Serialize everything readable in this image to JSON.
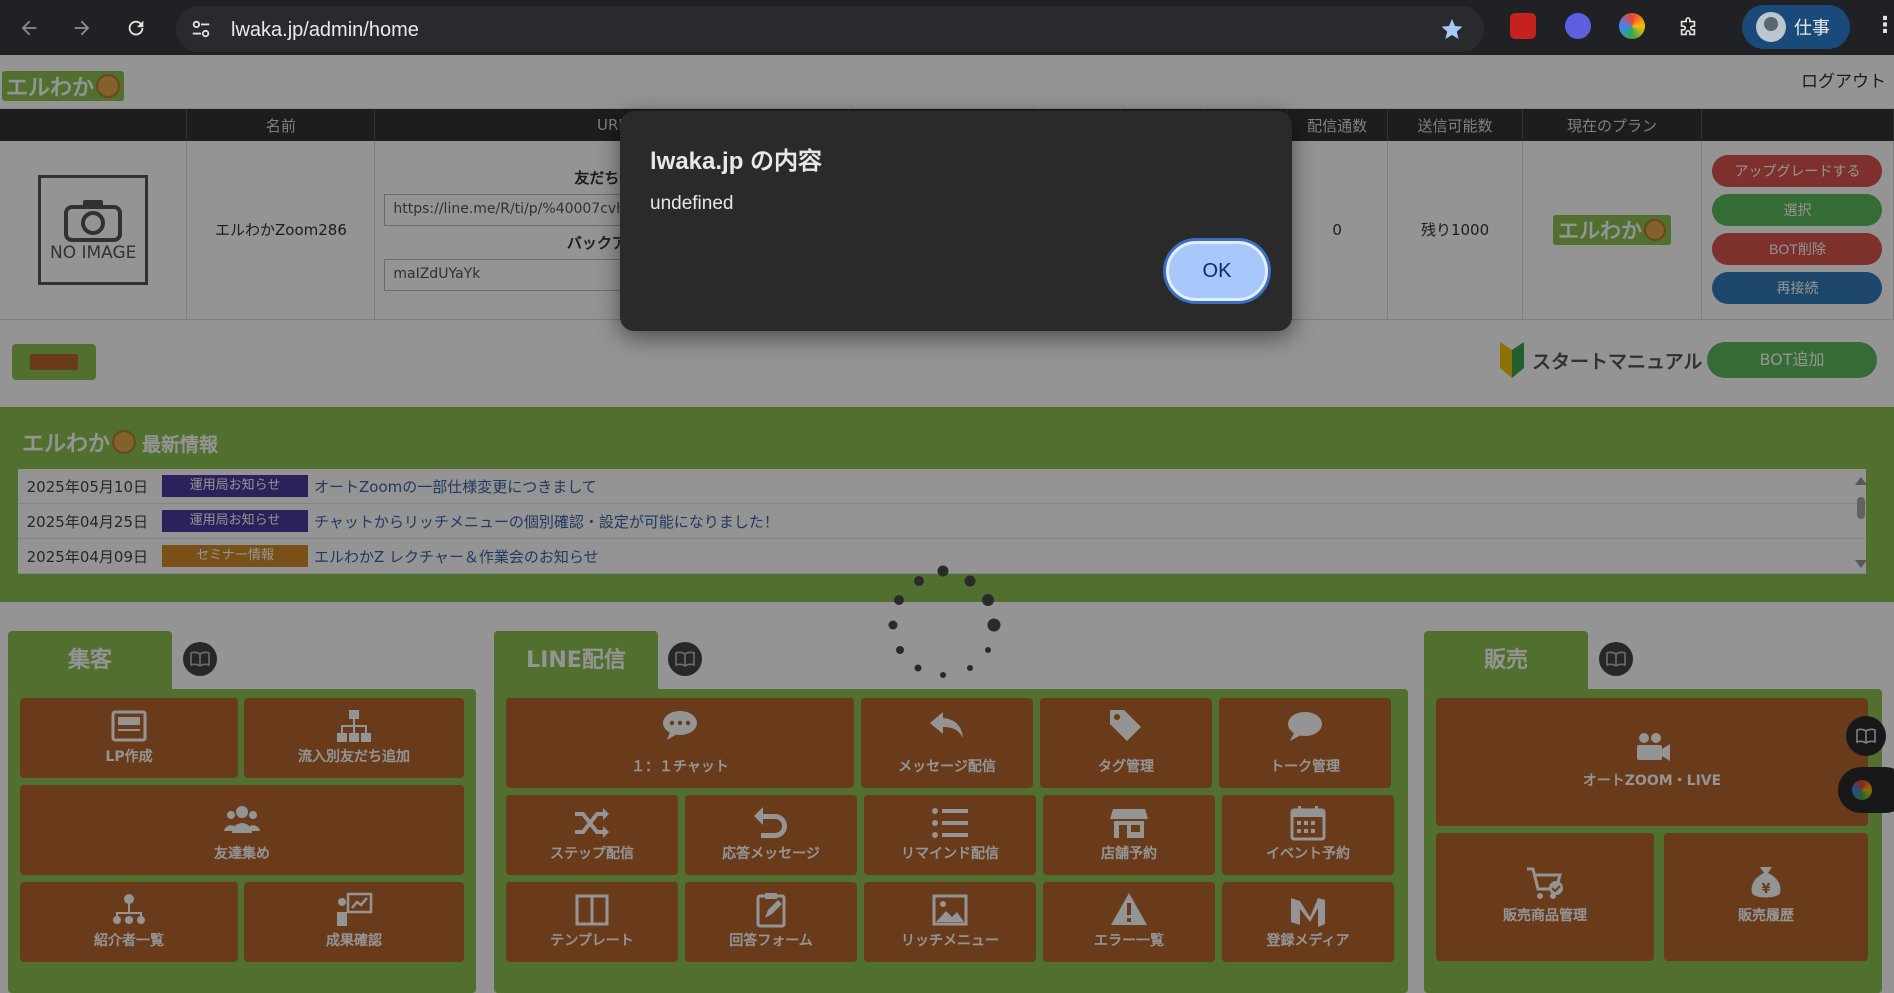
{
  "browser": {
    "url": "lwaka.jp/admin/home",
    "profile_label": "仕事"
  },
  "header": {
    "logo_text": "エルわか",
    "logout_label": "ログアウト"
  },
  "bot_table": {
    "headers": [
      "",
      "名前",
      "URL",
      "",
      "",
      "",
      "",
      "配信通数",
      "送信可能数",
      "現在のプラン",
      ""
    ],
    "row": {
      "no_image_label": "NO IMAGE",
      "name": "エルわかZoom286",
      "friend_add_label": "友だち追加",
      "friend_add_url": "https://line.me/R/ti/p/%40007cvh",
      "backup_label": "バックアップ",
      "backup_code": "maIZdUYaYk",
      "delivery_count": "0",
      "sendable": "残り1000",
      "plan_logo": "エルわか",
      "actions": {
        "upgrade": "アップグレードする",
        "select": "選択",
        "bot_delete": "BOT削除",
        "reconnect": "再接続"
      }
    }
  },
  "toolbar": {
    "start_manual_label": "スタートマニュアル",
    "bot_add_label": "BOT追加"
  },
  "news": {
    "logo_text": "エルわか",
    "title_suffix": "最新情報",
    "items": [
      {
        "date": "2025年05月10日",
        "tag": "運用局お知らせ",
        "tag_color": "#4b3a9e",
        "title": "オートZoomの一部仕様変更につきまして"
      },
      {
        "date": "2025年04月25日",
        "tag": "運用局お知らせ",
        "tag_color": "#4b3a9e",
        "title": "チャットからリッチメニューの個別確認・設定が可能になりました！"
      },
      {
        "date": "2025年04月09日",
        "tag": "セミナー情報",
        "tag_color": "#d08a2a",
        "title": "エルわかZ レクチャー＆作業会のお知らせ"
      }
    ]
  },
  "sections": {
    "shukyaku": {
      "title": "集客",
      "tiles": {
        "lp": "LP作成",
        "inflow": "流入別友だち追加",
        "friends": "友達集め",
        "referrers": "紹介者一覧",
        "results": "成果確認"
      }
    },
    "line": {
      "title": "LINE配信",
      "tiles": {
        "chat": "１：１チャット",
        "message": "メッセージ配信",
        "tag": "タグ管理",
        "talk": "トーク管理",
        "step": "ステップ配信",
        "response": "応答メッセージ",
        "remind": "リマインド配信",
        "shop": "店舗予約",
        "event": "イベント予約",
        "template": "テンプレート",
        "form": "回答フォーム",
        "richmenu": "リッチメニュー",
        "error": "エラー一覧",
        "media": "登録メディア"
      }
    },
    "hanbai": {
      "title": "販売",
      "tiles": {
        "zoom": "オートZOOM・LIVE",
        "products": "販売商品管理",
        "history": "販売履歴"
      }
    }
  },
  "dialog": {
    "title": "lwaka.jp の内容",
    "message": "undefined",
    "ok_label": "OK"
  },
  "colors": {
    "brand_green": "#8cc152",
    "tile_brown": "#b5672e",
    "upgrade": "#d9534f",
    "select": "#5cb85c",
    "delete": "#d9534f",
    "reconnect": "#337ab7"
  }
}
